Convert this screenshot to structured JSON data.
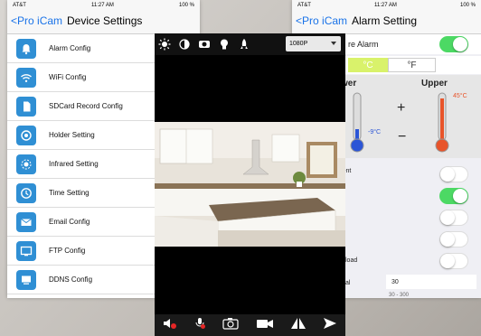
{
  "device_settings": {
    "status": {
      "carrier": "AT&T",
      "time": "11:27 AM",
      "battery": "100 %"
    },
    "back_label": "Pro iCam",
    "title": "Device Settings",
    "items": [
      {
        "label": "Alarm Config",
        "icon": "alarm-bell-icon"
      },
      {
        "label": "WiFi Config",
        "icon": "wifi-icon"
      },
      {
        "label": "SDCard Record Config",
        "icon": "sdcard-icon"
      },
      {
        "label": "Holder Setting",
        "icon": "holder-target-icon"
      },
      {
        "label": "Infrared Setting",
        "icon": "infrared-icon"
      },
      {
        "label": "Time Setting",
        "icon": "clock-icon"
      },
      {
        "label": "Email Config",
        "icon": "email-icon"
      },
      {
        "label": "FTP Config",
        "icon": "ftp-icon"
      },
      {
        "label": "DDNS Config",
        "icon": "ddns-icon"
      }
    ]
  },
  "camera": {
    "resolution": "1080P",
    "toolbar_icons": [
      "brightness-icon",
      "contrast-icon",
      "flip-icon",
      "bulb-icon",
      "rocket-icon"
    ],
    "bottom_icons": [
      "speaker-mute-icon",
      "microphone-icon",
      "camera-snapshot-icon",
      "video-record-icon",
      "mirror-icon",
      "send-icon"
    ]
  },
  "alarm_setting": {
    "status": {
      "carrier": "AT&T",
      "time": "11:27 AM",
      "battery": "100 %"
    },
    "back_label": "Pro iCam",
    "title": "Alarm Setting",
    "temperature_alarm_label": "re Alarm",
    "unit_c": "°C",
    "unit_f": "°F",
    "lower_label": "wer",
    "upper_label": "Upper",
    "lower_value": "-9°C",
    "upper_value": "45°C",
    "plus": "+",
    "minus": "−",
    "management_label": "gement",
    "upload_label": "load",
    "interval_label": "al",
    "interval_value": "30",
    "range_hint": "30 - 300",
    "colors": {
      "toggle_on": "#4cd964",
      "accent": "#1a73e8",
      "celsius_bg": "#d9f26b",
      "thermo_red": "#e8542a",
      "thermo_blue": "#2b55d6"
    }
  }
}
